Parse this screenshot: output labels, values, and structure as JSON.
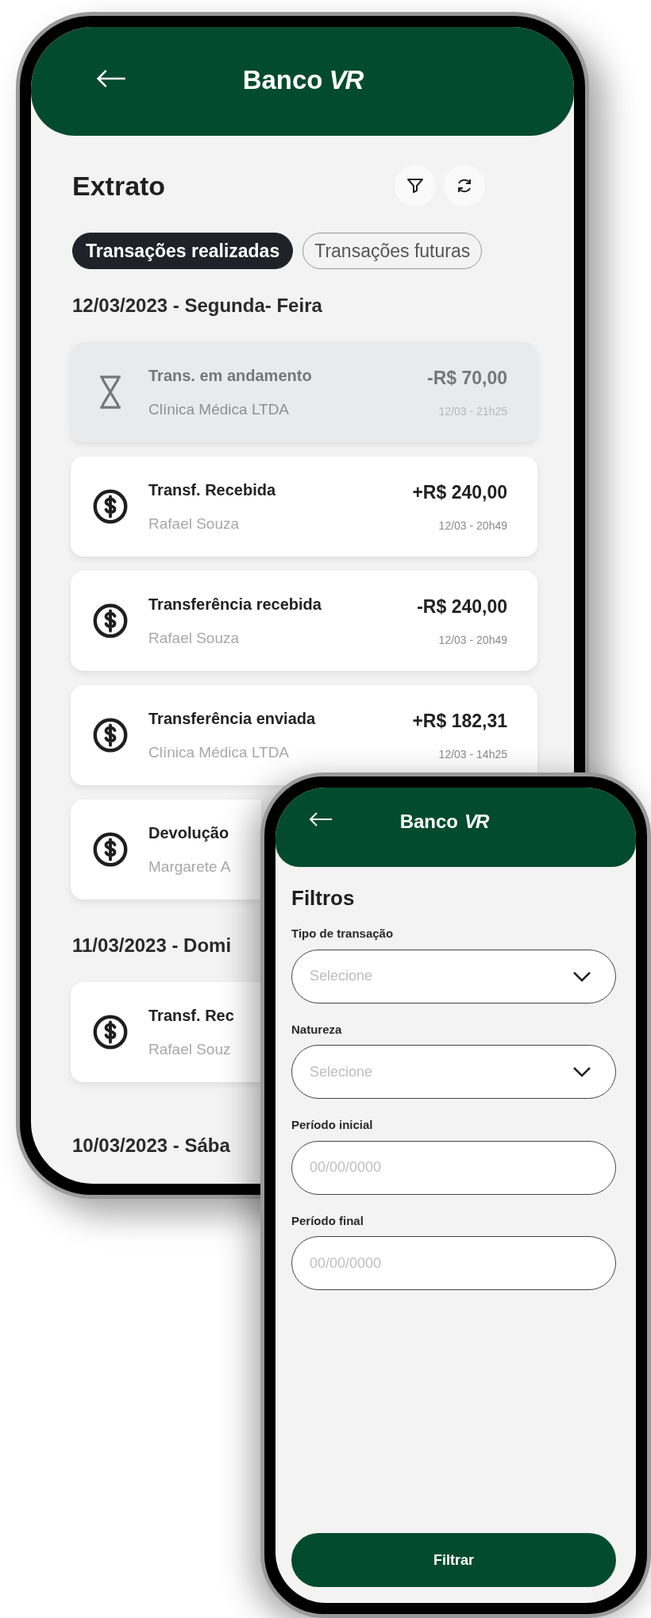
{
  "statement_screen": {
    "header": {
      "title": "Banco",
      "logo": "VR"
    },
    "title": "Extrato",
    "tabs": [
      {
        "label": "Transações realizadas",
        "selected": true
      },
      {
        "label": "Transações futuras",
        "selected": false
      }
    ],
    "groups": [
      {
        "date": "12/03/2023 - Segunda- Feira",
        "transactions": [
          {
            "kind": "pending",
            "title": "Trans. em andamento",
            "party": "Clínica Médica LTDA",
            "amount": "-R$ 70,00",
            "time": "12/03 - 21h25"
          },
          {
            "kind": "completed",
            "title": "Transf. Recebida",
            "party": "Rafael Souza",
            "amount": "+R$ 240,00",
            "time": "12/03 - 20h49"
          },
          {
            "kind": "completed",
            "title": "Transferência recebida",
            "party": "Rafael Souza",
            "amount": "-R$ 240,00",
            "time": "12/03 - 20h49"
          },
          {
            "kind": "completed",
            "title": "Transferência enviada",
            "party": "Clínica Médica LTDA",
            "amount": "+R$ 182,31",
            "time": "12/03 - 14h25"
          },
          {
            "kind": "completed",
            "title": "Devolução",
            "party": "Margarete A"
          }
        ]
      },
      {
        "date": "11/03/2023 - Domi",
        "transactions": [
          {
            "kind": "completed",
            "title": "Transf. Rec",
            "party": "Rafael Souz"
          }
        ]
      },
      {
        "date": "10/03/2023 - Sába"
      }
    ]
  },
  "filter_screen": {
    "header": {
      "title": "Banco",
      "logo": "VR"
    },
    "title": "Filtros",
    "fields": [
      {
        "kind": "select",
        "label": "Tipo de transação",
        "placeholder": "Selecione"
      },
      {
        "kind": "select",
        "label": "Natureza",
        "placeholder": "Selecione"
      },
      {
        "kind": "text",
        "label": "Período inicial",
        "placeholder": "00/00/0000"
      },
      {
        "kind": "text",
        "label": "Período final",
        "placeholder": "00/00/0000"
      }
    ],
    "button": "Filtrar"
  }
}
